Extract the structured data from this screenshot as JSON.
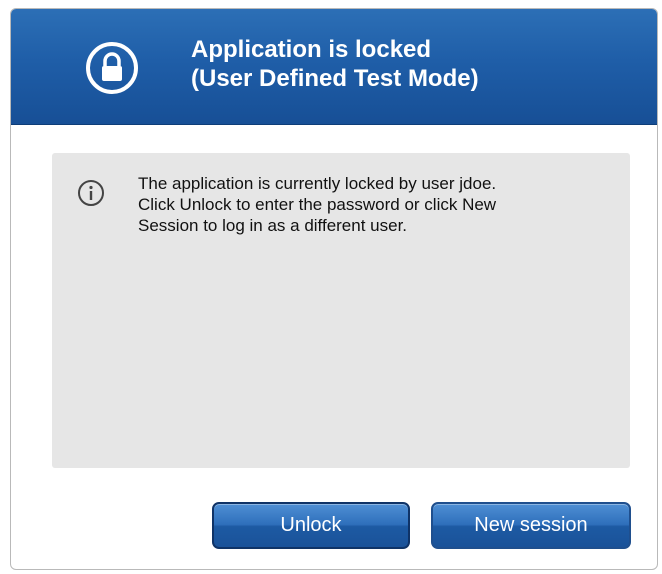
{
  "dialog": {
    "title_line1": "Application is locked",
    "title_line2": "(User Defined Test Mode)",
    "header_icon": "lock-icon",
    "info_icon": "info-icon",
    "message_lines": [
      "The application is currently locked by user jdoe.",
      "Click Unlock to enter the password or click New",
      "Session to log in as a different user."
    ]
  },
  "buttons": {
    "unlock_label": "Unlock",
    "new_session_label": "New session"
  },
  "colors": {
    "header_blue": "#1f5ea8",
    "panel_gray": "#e6e6e6",
    "button_blue": "#2e6fbb"
  }
}
